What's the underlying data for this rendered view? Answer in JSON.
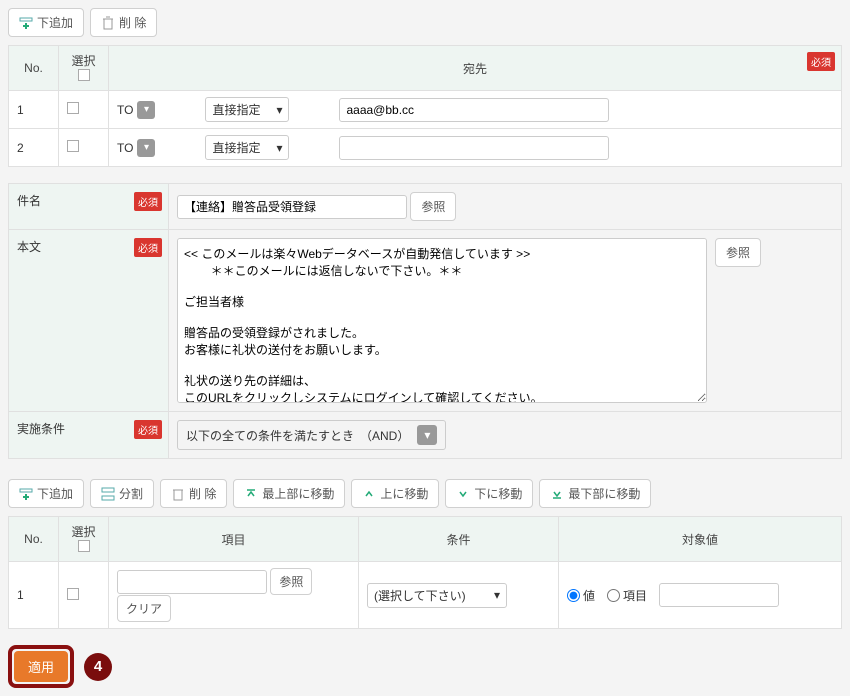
{
  "toolbar1": {
    "add_below": "下追加",
    "delete": "削 除"
  },
  "recipients": {
    "headers": {
      "no": "No.",
      "select": "選択",
      "dest": "宛先",
      "required": "必須"
    },
    "rows": [
      {
        "no": "1",
        "type": "TO",
        "mode": "直接指定",
        "addr": "aaaa@bb.cc"
      },
      {
        "no": "2",
        "type": "TO",
        "mode": "直接指定",
        "addr": ""
      }
    ]
  },
  "form": {
    "subject_label": "件名",
    "subject_value": "【連絡】贈答品受領登録",
    "ref_btn": "参照",
    "body_label": "本文",
    "body_value": "<< このメールは楽々Webデータベースが自動発信しています >>\n        ＊＊このメールには返信しないで下さい。＊＊\n\nご担当者様\n\n贈答品の受領登録がされました。\nお客様に礼状の送付をお願いします。\n\n礼状の送り先の詳細は、\nこのURLをクリックしシステムにログインして確認してください。\n %url_inq%",
    "cond_label": "実施条件",
    "cond_value": "以下の全ての条件を満たすとき　（AND）",
    "required": "必須"
  },
  "toolbar2": {
    "add_below": "下追加",
    "split": "分割",
    "delete": "削 除",
    "move_top": "最上部に移動",
    "move_up": "上に移動",
    "move_down": "下に移動",
    "move_bottom": "最下部に移動"
  },
  "conditions": {
    "headers": {
      "no": "No.",
      "select": "選択",
      "item": "項目",
      "cond": "条件",
      "target": "対象値"
    },
    "ref_btn": "参照",
    "clear_btn": "クリア",
    "rows": [
      {
        "no": "1",
        "item": "",
        "cond": "(選択して下さい)",
        "radio_value": "値",
        "radio_item": "項目",
        "target": ""
      }
    ]
  },
  "apply": {
    "label": "適用",
    "annotation": "4"
  },
  "icons": {
    "caret": "▾"
  }
}
